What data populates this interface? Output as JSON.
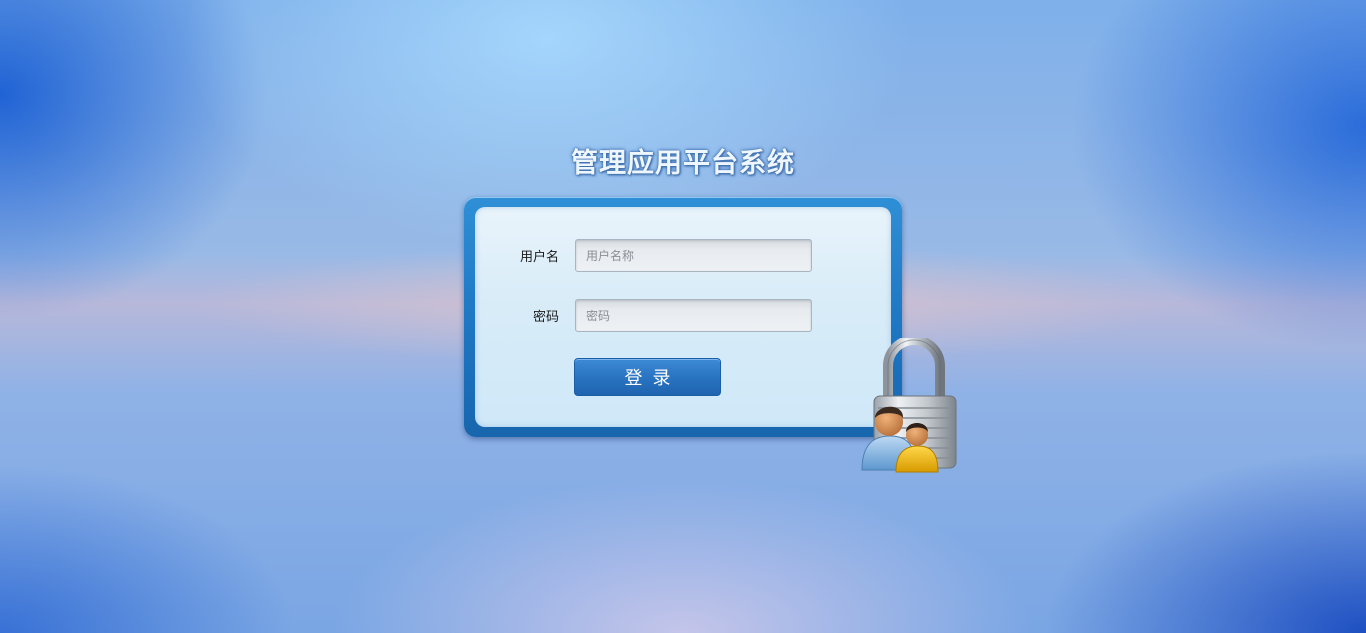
{
  "app": {
    "title": "管理应用平台系统"
  },
  "login_form": {
    "username_label": "用户名",
    "username_value": "",
    "username_placeholder": "用户名称",
    "password_label": "密码",
    "password_value": "",
    "password_placeholder": "密码",
    "submit_label": "登录"
  },
  "icons": {
    "illustration": "padlock-with-users-icon"
  },
  "colors": {
    "panel_border": "#1e78c4",
    "button": "#2a74c2",
    "title_text": "#eef6ff"
  }
}
